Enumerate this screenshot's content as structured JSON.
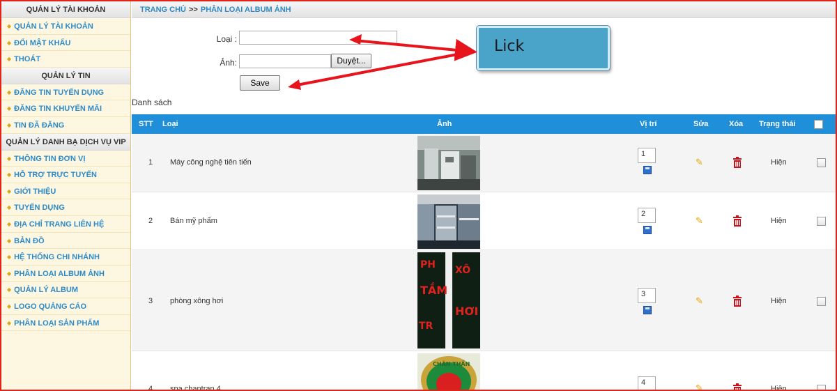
{
  "sidebar": {
    "sections": [
      {
        "title": "QUẢN LÝ TÀI KHOẢN",
        "items": [
          "QUẢN LÝ TÀI KHOẢN",
          "ĐỔI MẬT KHẨU",
          "THOÁT"
        ]
      },
      {
        "title": "QUẢN LÝ TIN",
        "items": [
          "ĐĂNG TIN TUYỂN DỤNG",
          "ĐĂNG TIN KHUYẾN MÃI",
          "TIN ĐÃ ĐĂNG"
        ]
      },
      {
        "title": "QUẢN LÝ DANH BẠ DỊCH VỤ VIP",
        "items": [
          "THÔNG TIN ĐƠN VỊ",
          "HỖ TRỢ TRỰC TUYẾN",
          "GIỚI THIỆU",
          "TUYỂN DỤNG",
          "ĐỊA CHỈ TRANG LIÊN HỆ",
          "BẢN ĐỒ",
          "HỆ THỐNG CHI NHÁNH",
          "PHÂN LOẠI ALBUM ẢNH",
          "QUẢN LÝ ALBUM",
          "LOGO QUẢNG CÁO",
          "PHÂN LOẠI SẢN PHẨM"
        ]
      }
    ]
  },
  "breadcrumb": {
    "home": "TRANG CHỦ",
    "separator": ">>",
    "current": "PHÂN LOẠI ALBUM ẢNH"
  },
  "form": {
    "loai_label": "Loại :",
    "loai_value": "",
    "anh_label": "Ảnh:",
    "anh_value": "",
    "browse_label": "Duyệt...",
    "save_label": "Save"
  },
  "callout": {
    "text": "Lick"
  },
  "list_title": "Danh sách",
  "table": {
    "columns": [
      "STT",
      "Loại",
      "Ảnh",
      "Vị trí",
      "Sửa",
      "Xóa",
      "Trạng thái"
    ],
    "rows": [
      {
        "stt": "1",
        "loai": "Máy công nghệ tiên tiến",
        "vitri": "1",
        "trangthai": "Hiện",
        "image": "machine-room-photo"
      },
      {
        "stt": "2",
        "loai": "Bán mỹ phẩm",
        "vitri": "2",
        "trangthai": "Hiện",
        "image": "cosmetics-shelf-photo"
      },
      {
        "stt": "3",
        "loai": "phòng xông hơi",
        "vitri": "3",
        "trangthai": "Hiện",
        "image": "steam-room-sign-photo"
      },
      {
        "stt": "4",
        "loai": "spa chantran 4",
        "vitri": "4",
        "trangthai": "Hiện",
        "image": "spa-logo-photo"
      }
    ]
  },
  "colors": {
    "header_blue": "#1e8fd8",
    "link_blue": "#2c8ac9",
    "border_red": "#e2231a",
    "arrow_red": "#e8141c",
    "callout_blue": "#4aa3c9"
  }
}
